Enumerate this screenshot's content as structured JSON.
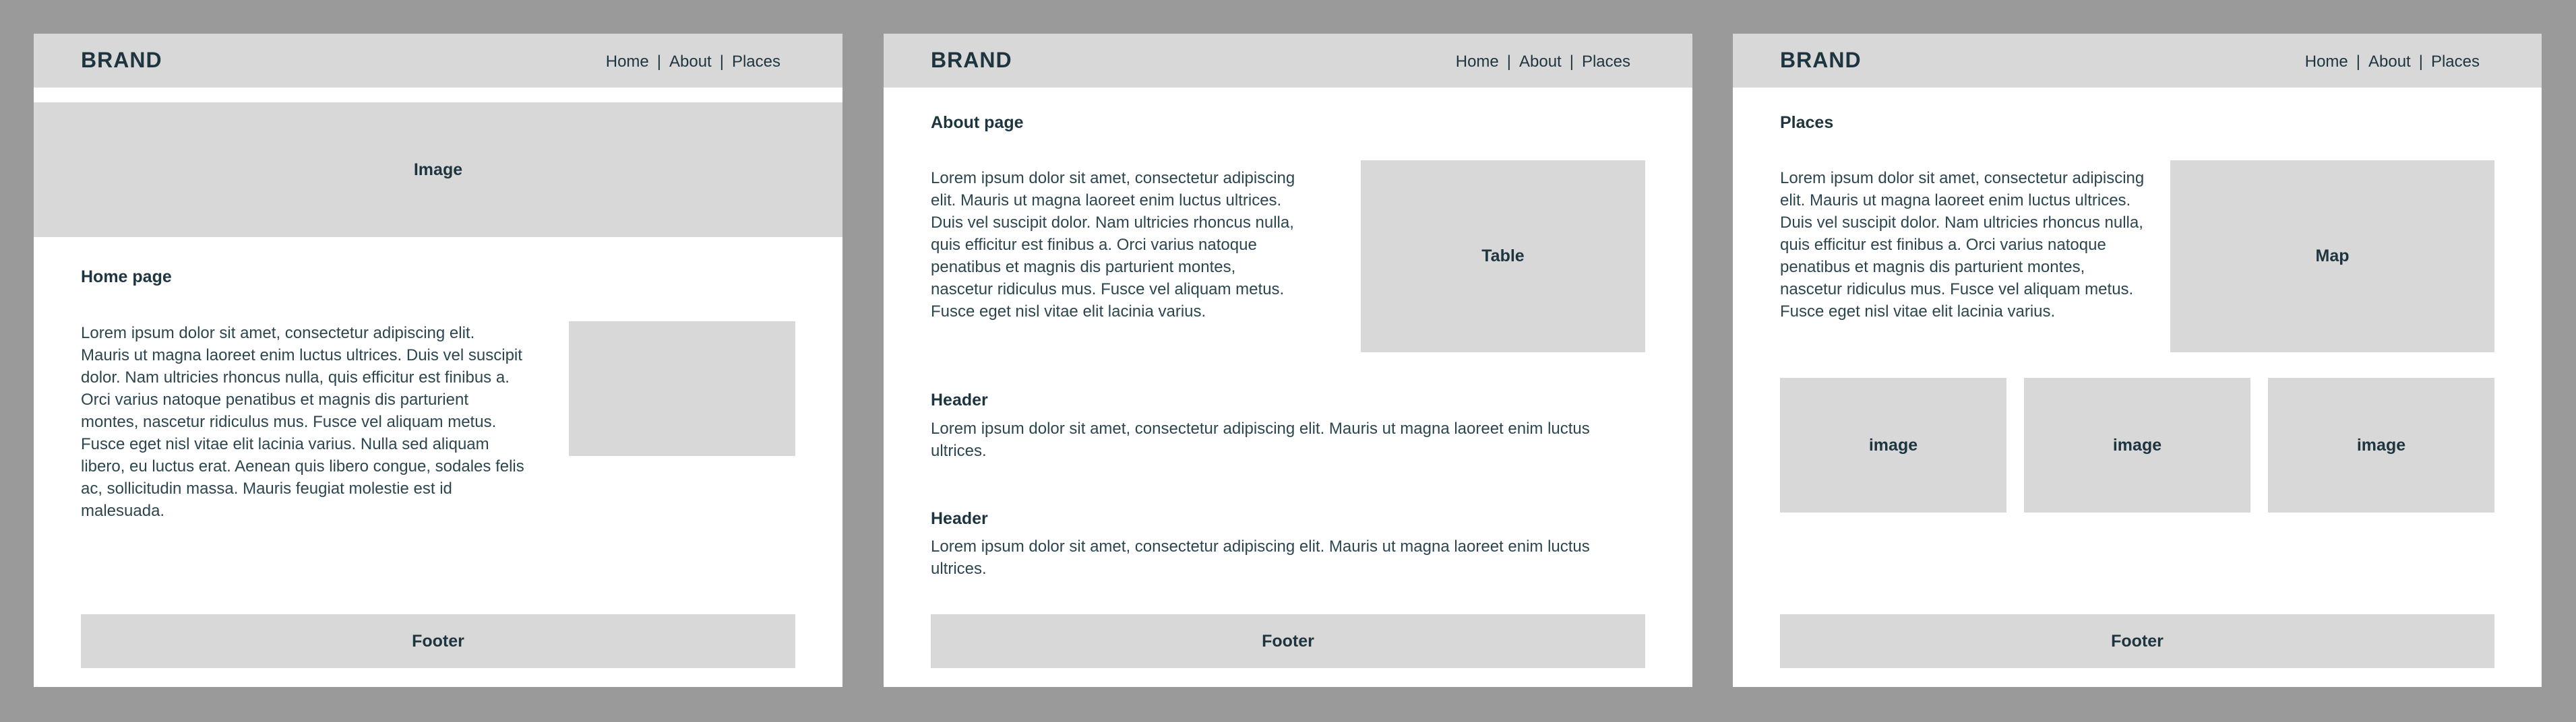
{
  "nav": {
    "brand": "BRAND",
    "links": [
      "Home",
      "About",
      "Places"
    ],
    "separator": "|"
  },
  "home": {
    "hero_label": "Image",
    "title": "Home page",
    "paragraph": "Lorem ipsum dolor sit amet, consectetur adipiscing elit. Mauris ut magna laoreet enim luctus ultrices. Duis vel suscipit dolor. Nam ultricies rhoncus nulla, quis efficitur est finibus a. Orci varius natoque penatibus et magnis dis parturient montes, nascetur ridiculus mus. Fusce vel aliquam metus. Fusce eget nisl vitae elit lacinia varius. Nulla sed aliquam libero, eu luctus erat. Aenean quis libero congue, sodales felis ac, sollicitudin massa. Mauris feugiat molestie est id malesuada.",
    "footer": "Footer"
  },
  "about": {
    "title": "About page",
    "paragraph": "Lorem ipsum dolor sit amet, consectetur adipiscing elit. Mauris ut magna laoreet enim luctus ultrices. Duis vel suscipit dolor. Nam ultricies rhoncus nulla, quis efficitur est finibus a. Orci varius natoque penatibus et magnis dis parturient montes, nascetur ridiculus mus. Fusce vel aliquam metus. Fusce eget nisl vitae elit lacinia varius.",
    "table_label": "Table",
    "sections": [
      {
        "header": "Header",
        "text": "Lorem ipsum dolor sit amet, consectetur adipiscing elit. Mauris ut magna laoreet enim luctus ultrices."
      },
      {
        "header": "Header",
        "text": "Lorem ipsum dolor sit amet, consectetur adipiscing elit. Mauris ut magna laoreet enim luctus ultrices."
      }
    ],
    "footer": "Footer"
  },
  "places": {
    "title": "Places",
    "paragraph": "Lorem ipsum dolor sit amet, consectetur adipiscing elit. Mauris ut magna laoreet enim luctus ultrices. Duis vel suscipit dolor. Nam ultricies rhoncus nulla, quis efficitur est finibus a. Orci varius natoque penatibus et magnis dis parturient montes, nascetur ridiculus mus. Fusce vel aliquam metus. Fusce eget nisl vitae elit lacinia varius.",
    "map_label": "Map",
    "images": [
      "image",
      "image",
      "image"
    ],
    "footer": "Footer"
  }
}
